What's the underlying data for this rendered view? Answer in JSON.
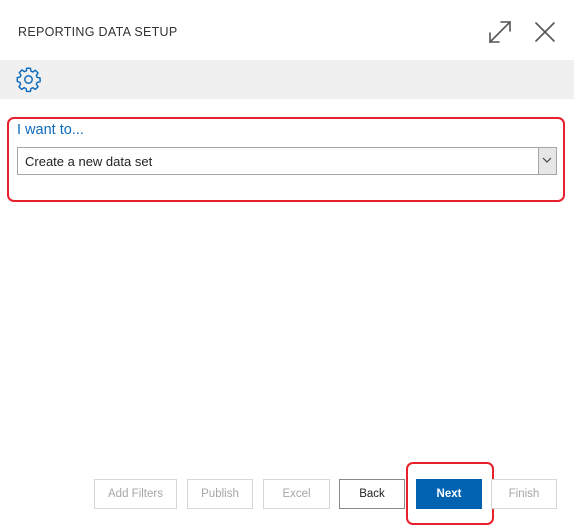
{
  "dialog": {
    "title": "REPORTING DATA SETUP"
  },
  "header_icons": [
    "expand-icon",
    "close-icon"
  ],
  "toolbar": {
    "icon": "gear-icon"
  },
  "form": {
    "label": "I want to...",
    "select_value": "Create a new data set"
  },
  "buttons": {
    "add_filters": "Add Filters",
    "publish": "Publish",
    "excel": "Excel",
    "back": "Back",
    "next": "Next",
    "finish": "Finish"
  },
  "colors": {
    "accent": "#0f6cbd",
    "primary_button": "#0062b1",
    "highlight": "#e8202d",
    "toolbar_bg": "#f0f0f0"
  }
}
